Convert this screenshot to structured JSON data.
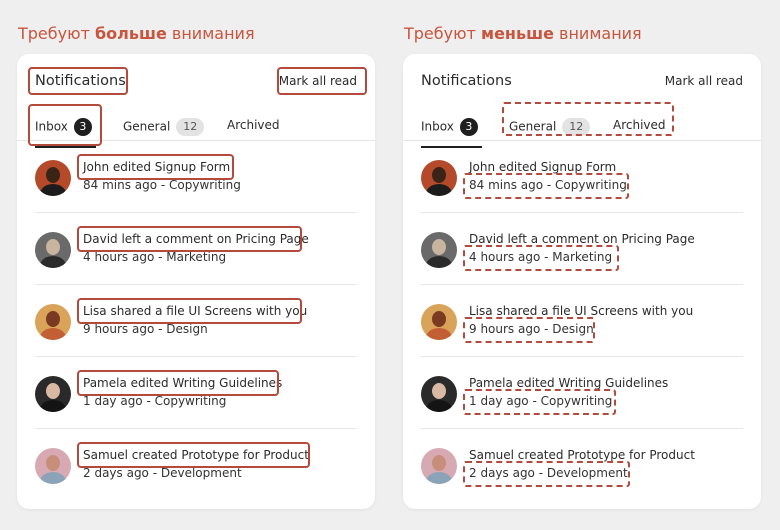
{
  "headings": {
    "left": {
      "prefix": "Требуют ",
      "emphasis": "больше",
      "suffix": " внимания"
    },
    "right": {
      "prefix": "Требуют ",
      "emphasis": "меньше",
      "suffix": " внимания"
    }
  },
  "card": {
    "title": "Notifications",
    "mark_all_read": "Mark all read",
    "tabs": [
      {
        "label": "Inbox",
        "count": "3"
      },
      {
        "label": "General",
        "count": "12"
      },
      {
        "label": "Archived"
      }
    ],
    "items": [
      {
        "title": "John edited Signup Form",
        "meta": "84 mins ago - Copywriting",
        "avatar": "john-avatar"
      },
      {
        "title": "David left a comment on Pricing Page",
        "meta": "4 hours ago - Marketing",
        "avatar": "david-avatar"
      },
      {
        "title": "Lisa shared a file UI Screens with you",
        "meta": "9 hours ago - Design",
        "avatar": "lisa-avatar"
      },
      {
        "title": "Pamela edited Writing Guidelines",
        "meta": "1 day ago - Copywriting",
        "avatar": "pamela-avatar"
      },
      {
        "title": "Samuel created Prototype for Product",
        "meta": "2 days ago - Development",
        "avatar": "samuel-avatar"
      }
    ]
  },
  "colors": {
    "annotation": "#b34a3c",
    "heading": "#c8553d"
  }
}
